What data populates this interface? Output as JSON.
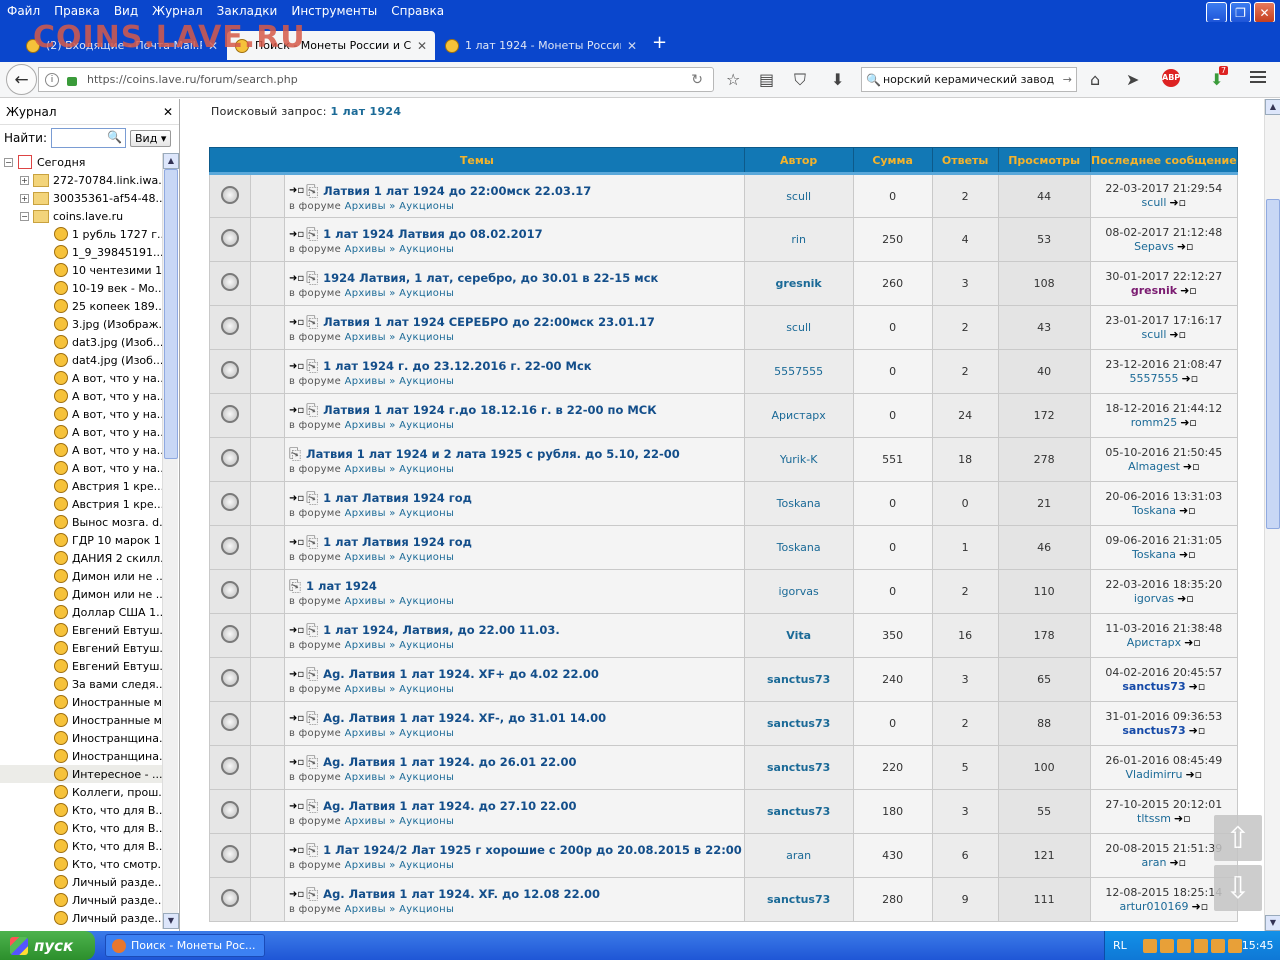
{
  "menu": [
    "Файл",
    "Правка",
    "Вид",
    "Журнал",
    "Закладки",
    "Инструменты",
    "Справка"
  ],
  "tabs": [
    {
      "title": "(2) Входящие - Почта Mail.Ru"
    },
    {
      "title": "Поиск - Монеты России и СС..."
    },
    {
      "title": "1 лат 1924 - Монеты России..."
    }
  ],
  "watermark": "COINS.LAVE.RU",
  "url": "https://coins.lave.ru/forum/search.php",
  "search_value": "норский керамический завод",
  "download_badge": "7",
  "abp_label": "ABP",
  "sidebar": {
    "title": "Журнал",
    "find_label": "Найти:",
    "view_button": "Вид",
    "items": [
      {
        "label": "Сегодня",
        "type": "cal",
        "exp": "−",
        "indent": 4
      },
      {
        "label": "272-70784.link.iwa...",
        "type": "folder",
        "exp": "+",
        "indent": 20
      },
      {
        "label": "30035361-af54-48...",
        "type": "folder",
        "exp": "+",
        "indent": 20
      },
      {
        "label": "coins.lave.ru",
        "type": "folder",
        "exp": "−",
        "indent": 20
      },
      {
        "label": "1 рубль 1727 г...",
        "type": "page"
      },
      {
        "label": "1_9_39845191....",
        "type": "page"
      },
      {
        "label": "10 чентезими 1...",
        "type": "page"
      },
      {
        "label": "10-19 век - Мо...",
        "type": "page"
      },
      {
        "label": "25 копеек 189...",
        "type": "page"
      },
      {
        "label": "3.jpg (Изображ...",
        "type": "page"
      },
      {
        "label": "dat3.jpg (Изоб...",
        "type": "page"
      },
      {
        "label": "dat4.jpg (Изоб...",
        "type": "page"
      },
      {
        "label": "А вот, что у на...",
        "type": "page"
      },
      {
        "label": "А вот, что у на...",
        "type": "page"
      },
      {
        "label": "А вот, что у на...",
        "type": "page"
      },
      {
        "label": "А вот, что у на...",
        "type": "page"
      },
      {
        "label": "А вот, что у на...",
        "type": "page"
      },
      {
        "label": "А вот, что у на...",
        "type": "page"
      },
      {
        "label": "Австрия 1 кре...",
        "type": "page"
      },
      {
        "label": "Австрия 1 кре...",
        "type": "page"
      },
      {
        "label": "Вынос мозга. d...",
        "type": "page"
      },
      {
        "label": "ГДР 10 марок 1...",
        "type": "page"
      },
      {
        "label": "ДАНИЯ 2 скилл...",
        "type": "page"
      },
      {
        "label": "Димон или не ...",
        "type": "page"
      },
      {
        "label": "Димон или не ...",
        "type": "page"
      },
      {
        "label": "Доллар США 1...",
        "type": "page"
      },
      {
        "label": "Евгений Евтуш...",
        "type": "page"
      },
      {
        "label": "Евгений Евтуш...",
        "type": "page"
      },
      {
        "label": "Евгений Евтуш...",
        "type": "page"
      },
      {
        "label": "За вами следя...",
        "type": "page"
      },
      {
        "label": "Иностранные м...",
        "type": "page"
      },
      {
        "label": "Иностранные м...",
        "type": "page"
      },
      {
        "label": "Иностранщина...",
        "type": "page"
      },
      {
        "label": "Иностранщина...",
        "type": "page"
      },
      {
        "label": "Интересное - ...",
        "type": "page",
        "selected": true
      },
      {
        "label": "Коллеги, прош...",
        "type": "page"
      },
      {
        "label": "Кто, что для В...",
        "type": "page"
      },
      {
        "label": "Кто, что для В...",
        "type": "page"
      },
      {
        "label": "Кто, что для В...",
        "type": "page"
      },
      {
        "label": "Кто, что смотр...",
        "type": "page"
      },
      {
        "label": "Личный разде...",
        "type": "page"
      },
      {
        "label": "Личный разде...",
        "type": "page"
      },
      {
        "label": "Личный разде...",
        "type": "page"
      }
    ]
  },
  "query": {
    "label": "Поисковый запрос:",
    "value": "1 лат 1924"
  },
  "table": {
    "headers": [
      "Темы",
      "Автор",
      "Сумма",
      "Ответы",
      "Просмотры",
      "Последнее сообщение"
    ],
    "forum_prefix": "в форуме",
    "forum_path": "Архивы » Аукционы",
    "rows": [
      {
        "title": "Латвия 1 лат 1924 до 22:00мск 22.03.17",
        "go": true,
        "author": "scull",
        "style": "norm",
        "sum": "0",
        "replies": "2",
        "views": "44",
        "date": "22-03-2017 21:29:54",
        "last": "scull",
        "last_style": "norm"
      },
      {
        "title": "1 лат 1924 Латвия до 08.02.2017",
        "go": true,
        "author": "rin",
        "style": "norm",
        "sum": "250",
        "replies": "4",
        "views": "53",
        "date": "08-02-2017 21:12:48",
        "last": "Sepavs",
        "last_style": "norm"
      },
      {
        "title": "1924 Латвия, 1 лат, серебро, до 30.01 в 22-15 мск",
        "go": true,
        "author": "gresnik",
        "style": "purple",
        "sum": "260",
        "replies": "3",
        "views": "108",
        "date": "30-01-2017 22:12:27",
        "last": "gresnik",
        "last_style": "purple"
      },
      {
        "title": "Латвия 1 лат 1924 СЕРЕБРО до 22:00мск 23.01.17",
        "go": true,
        "author": "scull",
        "style": "norm",
        "sum": "0",
        "replies": "2",
        "views": "43",
        "date": "23-01-2017 17:16:17",
        "last": "scull",
        "last_style": "norm"
      },
      {
        "title": "1 лат 1924 г. до 23.12.2016 г. 22-00 Мск",
        "go": true,
        "author": "5557555",
        "style": "norm",
        "sum": "0",
        "replies": "2",
        "views": "40",
        "date": "23-12-2016 21:08:47",
        "last": "5557555",
        "last_style": "norm"
      },
      {
        "title": "Латвия 1 лат 1924 г.до 18.12.16 г. в 22-00 по МСК",
        "go": true,
        "author": "Аристарх",
        "style": "norm",
        "sum": "0",
        "replies": "24",
        "views": "172",
        "date": "18-12-2016 21:44:12",
        "last": "romm25",
        "last_style": "norm"
      },
      {
        "title": "Латвия 1 лат 1924 и 2 лата 1925 с рубля. до 5.10, 22-00",
        "go": false,
        "author": "Yurik-K",
        "style": "norm",
        "sum": "551",
        "replies": "18",
        "views": "278",
        "date": "05-10-2016 21:50:45",
        "last": "Almagest",
        "last_style": "norm"
      },
      {
        "title": "1 лат Латвия 1924 год",
        "go": true,
        "author": "Toskana",
        "style": "norm",
        "sum": "0",
        "replies": "0",
        "views": "21",
        "date": "20-06-2016 13:31:03",
        "last": "Toskana",
        "last_style": "norm"
      },
      {
        "title": "1 лат Латвия 1924 год",
        "go": true,
        "author": "Toskana",
        "style": "norm",
        "sum": "0",
        "replies": "1",
        "views": "46",
        "date": "09-06-2016 21:31:05",
        "last": "Toskana",
        "last_style": "norm"
      },
      {
        "title": "1 лат 1924",
        "go": false,
        "author": "igorvas",
        "style": "norm",
        "sum": "0",
        "replies": "2",
        "views": "110",
        "date": "22-03-2016 18:35:20",
        "last": "igorvas",
        "last_style": "norm"
      },
      {
        "title": "1 лат 1924, Латвия, до 22.00 11.03.",
        "go": true,
        "author": "Vita",
        "style": "bold",
        "sum": "350",
        "replies": "16",
        "views": "178",
        "date": "11-03-2016 21:38:48",
        "last": "Аристарх",
        "last_style": "norm"
      },
      {
        "title": "Ag. Латвия 1 лат 1924. XF+ до 4.02 22.00",
        "go": true,
        "author": "sanctus73",
        "style": "bold",
        "sum": "240",
        "replies": "3",
        "views": "65",
        "date": "04-02-2016 20:45:57",
        "last": "sanctus73",
        "last_style": "bold"
      },
      {
        "title": "Ag. Латвия 1 лат 1924. XF-, до 31.01 14.00",
        "go": true,
        "author": "sanctus73",
        "style": "bold",
        "sum": "0",
        "replies": "2",
        "views": "88",
        "date": "31-01-2016 09:36:53",
        "last": "sanctus73",
        "last_style": "bold"
      },
      {
        "title": "Ag. Латвия 1 лат 1924. до 26.01 22.00",
        "go": true,
        "author": "sanctus73",
        "style": "bold",
        "sum": "220",
        "replies": "5",
        "views": "100",
        "date": "26-01-2016 08:45:49",
        "last": "Vladimirru",
        "last_style": "norm"
      },
      {
        "title": "Ag. Латвия 1 лат 1924. до 27.10 22.00",
        "go": true,
        "author": "sanctus73",
        "style": "bold",
        "sum": "180",
        "replies": "3",
        "views": "55",
        "date": "27-10-2015 20:12:01",
        "last": "tltssm",
        "last_style": "norm"
      },
      {
        "title": "1 Лат 1924/2 Лат 1925 г хорошие с 200р до 20.08.2015 в 22:00",
        "go": true,
        "author": "aran",
        "style": "norm",
        "sum": "430",
        "replies": "6",
        "views": "121",
        "date": "20-08-2015 21:51:39",
        "last": "aran",
        "last_style": "norm"
      },
      {
        "title": "Ag. Латвия 1 лат 1924. XF. до 12.08 22.00",
        "go": true,
        "author": "sanctus73",
        "style": "bold",
        "sum": "280",
        "replies": "9",
        "views": "111",
        "date": "12-08-2015 18:25:14",
        "last": "artur010169",
        "last_style": "norm"
      }
    ]
  },
  "taskbar": {
    "start": "пуск",
    "item": "Поиск - Монеты Рос...",
    "lang": "RL",
    "time": "15:45"
  }
}
